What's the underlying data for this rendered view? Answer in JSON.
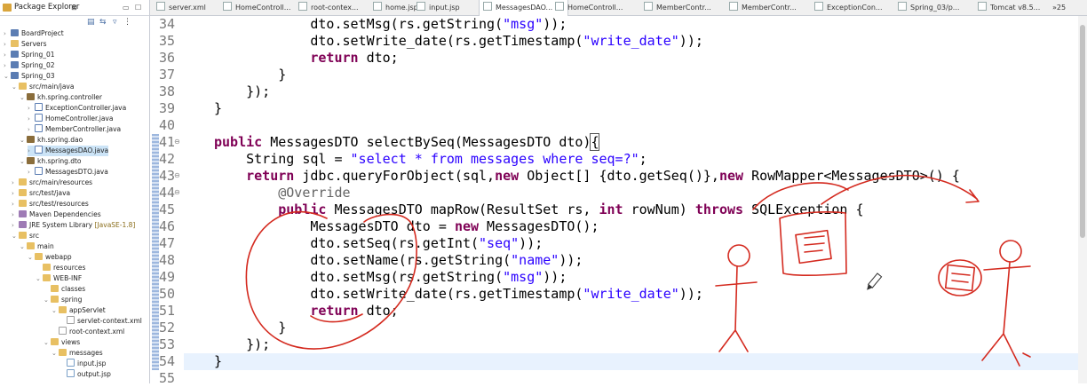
{
  "explorer": {
    "title": "Package Explorer",
    "items": [
      {
        "label": "BoardProject",
        "level": 0,
        "arrow": "›",
        "icon": "proj"
      },
      {
        "label": "Servers",
        "level": 0,
        "arrow": "›",
        "icon": "folder"
      },
      {
        "label": "Spring_01",
        "level": 0,
        "arrow": "›",
        "icon": "proj"
      },
      {
        "label": "Spring_02",
        "level": 0,
        "arrow": "›",
        "icon": "proj"
      },
      {
        "label": "Spring_03",
        "level": 0,
        "arrow": "⌄",
        "icon": "proj"
      },
      {
        "label": "src/main/java",
        "level": 1,
        "arrow": "⌄",
        "icon": "folder"
      },
      {
        "label": "kh.spring.controller",
        "level": 2,
        "arrow": "⌄",
        "icon": "pkg"
      },
      {
        "label": "ExceptionController.java",
        "level": 3,
        "arrow": "›",
        "icon": "java"
      },
      {
        "label": "HomeController.java",
        "level": 3,
        "arrow": "›",
        "icon": "java"
      },
      {
        "label": "MemberController.java",
        "level": 3,
        "arrow": "›",
        "icon": "java"
      },
      {
        "label": "kh.spring.dao",
        "level": 2,
        "arrow": "⌄",
        "icon": "pkg"
      },
      {
        "label": "MessagesDAO.java",
        "level": 3,
        "arrow": "›",
        "icon": "java",
        "selected": true
      },
      {
        "label": "kh.spring.dto",
        "level": 2,
        "arrow": "⌄",
        "icon": "pkg"
      },
      {
        "label": "MessagesDTO.java",
        "level": 3,
        "arrow": "›",
        "icon": "java"
      },
      {
        "label": "src/main/resources",
        "level": 1,
        "arrow": "›",
        "icon": "folder"
      },
      {
        "label": "src/test/java",
        "level": 1,
        "arrow": "›",
        "icon": "folder"
      },
      {
        "label": "src/test/resources",
        "level": 1,
        "arrow": "›",
        "icon": "folder"
      },
      {
        "label": "Maven Dependencies",
        "level": 1,
        "arrow": "›",
        "icon": "lib"
      },
      {
        "label": "JRE System Library",
        "tag": "[JavaSE-1.8]",
        "level": 1,
        "arrow": "›",
        "icon": "lib"
      },
      {
        "label": "src",
        "level": 1,
        "arrow": "⌄",
        "icon": "folder"
      },
      {
        "label": "main",
        "level": 2,
        "arrow": "⌄",
        "icon": "folder"
      },
      {
        "label": "webapp",
        "level": 3,
        "arrow": "⌄",
        "icon": "folder"
      },
      {
        "label": "resources",
        "level": 4,
        "arrow": "",
        "icon": "folder"
      },
      {
        "label": "WEB-INF",
        "level": 4,
        "arrow": "⌄",
        "icon": "folder"
      },
      {
        "label": "classes",
        "level": 5,
        "arrow": "",
        "icon": "folder"
      },
      {
        "label": "spring",
        "level": 5,
        "arrow": "⌄",
        "icon": "folder"
      },
      {
        "label": "appServlet",
        "level": 6,
        "arrow": "⌄",
        "icon": "folder"
      },
      {
        "label": "servlet-context.xml",
        "level": 7,
        "arrow": "",
        "icon": "xml"
      },
      {
        "label": "root-context.xml",
        "level": 6,
        "arrow": "",
        "icon": "xml"
      },
      {
        "label": "views",
        "level": 5,
        "arrow": "⌄",
        "icon": "folder"
      },
      {
        "label": "messages",
        "level": 6,
        "arrow": "⌄",
        "icon": "folder"
      },
      {
        "label": "input.jsp",
        "level": 7,
        "arrow": "",
        "icon": "jsp"
      },
      {
        "label": "output.jsp",
        "level": 7,
        "arrow": "",
        "icon": "jsp"
      }
    ]
  },
  "tabs": [
    {
      "label": "server.xml"
    },
    {
      "label": "HomeControll..."
    },
    {
      "label": "root-contex..."
    },
    {
      "label": "home.jsp"
    },
    {
      "label": "input.jsp"
    },
    {
      "label": "MessagesDAO...",
      "active": true
    },
    {
      "label": "HomeControll..."
    },
    {
      "label": "MemberContr..."
    },
    {
      "label": "MemberContr..."
    },
    {
      "label": "ExceptionCon..."
    },
    {
      "label": "Spring_03/p..."
    },
    {
      "label": "Tomcat v8.5..."
    },
    {
      "label": "»25"
    }
  ],
  "code": [
    {
      "n": "34",
      "html": "            dto.setMsg(rs.getString(<span class=\"s\">\"msg\"</span>));"
    },
    {
      "n": "35",
      "html": "            dto.setWrite_date(rs.getTimestamp(<span class=\"s\">\"write_date\"</span>));"
    },
    {
      "n": "36",
      "html": "            <span class=\"k\">return</span> dto;"
    },
    {
      "n": "37",
      "html": "        }"
    },
    {
      "n": "38",
      "html": "    });"
    },
    {
      "n": "39",
      "html": "}"
    },
    {
      "n": "40",
      "html": ""
    },
    {
      "n": "41",
      "html": "<span class=\"k\">public</span> MessagesDTO selectBySeq(MessagesDTO dto)<span class=\"bracket\">{</span>",
      "fold": true
    },
    {
      "n": "42",
      "html": "    String sql = <span class=\"s\">\"select * from messages where seq=?\"</span>;"
    },
    {
      "n": "43",
      "html": "    <span class=\"k\">return</span> jdbc.queryForObject(sql,<span class=\"k\">new</span> Object[] {dto.getSeq()},<span class=\"k\">new</span> RowMapper&lt;MessagesDTO&gt;() {",
      "fold": true
    },
    {
      "n": "44",
      "html": "        <span class=\"an\">@Override</span>",
      "fold": true
    },
    {
      "n": "45",
      "html": "        <span class=\"k\">public</span> MessagesDTO mapRow(ResultSet rs, <span class=\"k\">int</span> rowNum) <span class=\"k\">throws</span> SQLException {"
    },
    {
      "n": "46",
      "html": "            MessagesDTO dto = <span class=\"k\">new</span> MessagesDTO();"
    },
    {
      "n": "47",
      "html": "            dto.setSeq(rs.getInt(<span class=\"s\">\"seq\"</span>));"
    },
    {
      "n": "48",
      "html": "            dto.setName(rs.getString(<span class=\"s\">\"name\"</span>));"
    },
    {
      "n": "49",
      "html": "            dto.setMsg(rs.getString(<span class=\"s\">\"msg\"</span>));"
    },
    {
      "n": "50",
      "html": "            dto.setWrite_date(rs.getTimestamp(<span class=\"s\">\"write_date\"</span>));"
    },
    {
      "n": "51",
      "html": "            <span class=\"k\">return</span> dto;"
    },
    {
      "n": "52",
      "html": "        }"
    },
    {
      "n": "53",
      "html": "    });"
    },
    {
      "n": "54",
      "html": "}",
      "highlight": true
    },
    {
      "n": "55",
      "html": ""
    }
  ]
}
